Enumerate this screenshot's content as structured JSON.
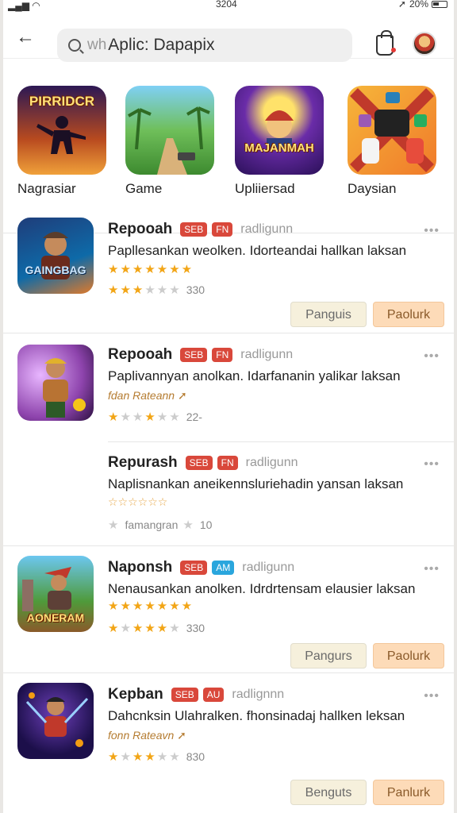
{
  "status": {
    "time": "3204",
    "battery": "20%"
  },
  "search": {
    "prefix": "wh",
    "query": "Aplic: Dapapix"
  },
  "categories": [
    {
      "label": "Nagrasiar",
      "tile_text": "PIRRIDCR"
    },
    {
      "label": "Game",
      "tile_text": ""
    },
    {
      "label": "Upliiersad",
      "tile_text": "MAJANMAH"
    },
    {
      "label": "Daysian",
      "tile_text": ""
    }
  ],
  "apps": [
    {
      "name": "Repooah",
      "badges": [
        "SEB",
        "FN"
      ],
      "developer": "radligunn",
      "desc": "Papllesankan weolken. Idorteandai hallkan laksan",
      "stars_text": "★★★★★★★",
      "rating": 3.5,
      "count": "330",
      "icon_text": "GAINGBAG",
      "btn1": "Panguis",
      "btn2": "Paolurk"
    },
    {
      "name": "Repooah",
      "badges": [
        "SEB",
        "FN"
      ],
      "developer": "radligunn",
      "desc": "Paplivannyan anolkan. Idarfananin yalikar laksan",
      "note": "fdan Rateann ➚",
      "rating": 2.5,
      "count": "22-",
      "icon_text": ""
    },
    {
      "name": "Repurash",
      "badges": [
        "SEB",
        "FN"
      ],
      "developer": "radligunn",
      "desc": "Naplisnankan aneikennsluriehadin yansan laksan",
      "stars_text": "☆☆☆☆☆☆",
      "rating_label": "famangran",
      "count": "10"
    },
    {
      "name": "Naponsh",
      "badges": [
        "SEB",
        "AM"
      ],
      "developer": "radligunn",
      "desc": "Nenausankan anolken. Idrdrtensam elausier laksan",
      "stars_text": "★★★★★★★",
      "rating": 4,
      "count": "330",
      "icon_text": "AONERAM",
      "btn1": "Pangurs",
      "btn2": "Paolurk"
    },
    {
      "name": "Kepban",
      "badges": [
        "SEB",
        "AU"
      ],
      "developer": "radlignnn",
      "desc": "Dahcnksin Ulahralken. fhonsinadaj hallken leksan",
      "note": "fonn Rateavn ➚",
      "rating": 3,
      "count": "830",
      "icon_text": "",
      "btn1": "Benguts",
      "btn2": "Panlurk"
    }
  ],
  "colors": {
    "accent": "#d9483b",
    "button_primary": "#fddbb8",
    "star": "#f2a516"
  }
}
